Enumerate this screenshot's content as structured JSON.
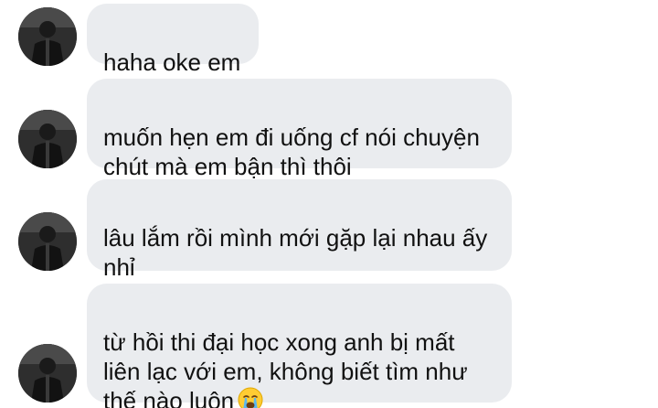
{
  "messages": [
    {
      "text": "haha oke em"
    },
    {
      "text": "muốn hẹn em đi uống cf nói chuyện\nchút mà em bận thì thôi"
    },
    {
      "text": "lâu lắm rồi mình mới gặp lại nhau ấy\nnhỉ"
    },
    {
      "text": "từ hồi thi đại học xong anh bị mất\nliên lạc với em, không biết tìm như\nthế nào luôn",
      "emoji": "loudly-crying-face-icon"
    }
  ],
  "colors": {
    "bubble_bg": "#eaecef",
    "text": "#111111",
    "avatar_bg": "#2b2b2b"
  }
}
